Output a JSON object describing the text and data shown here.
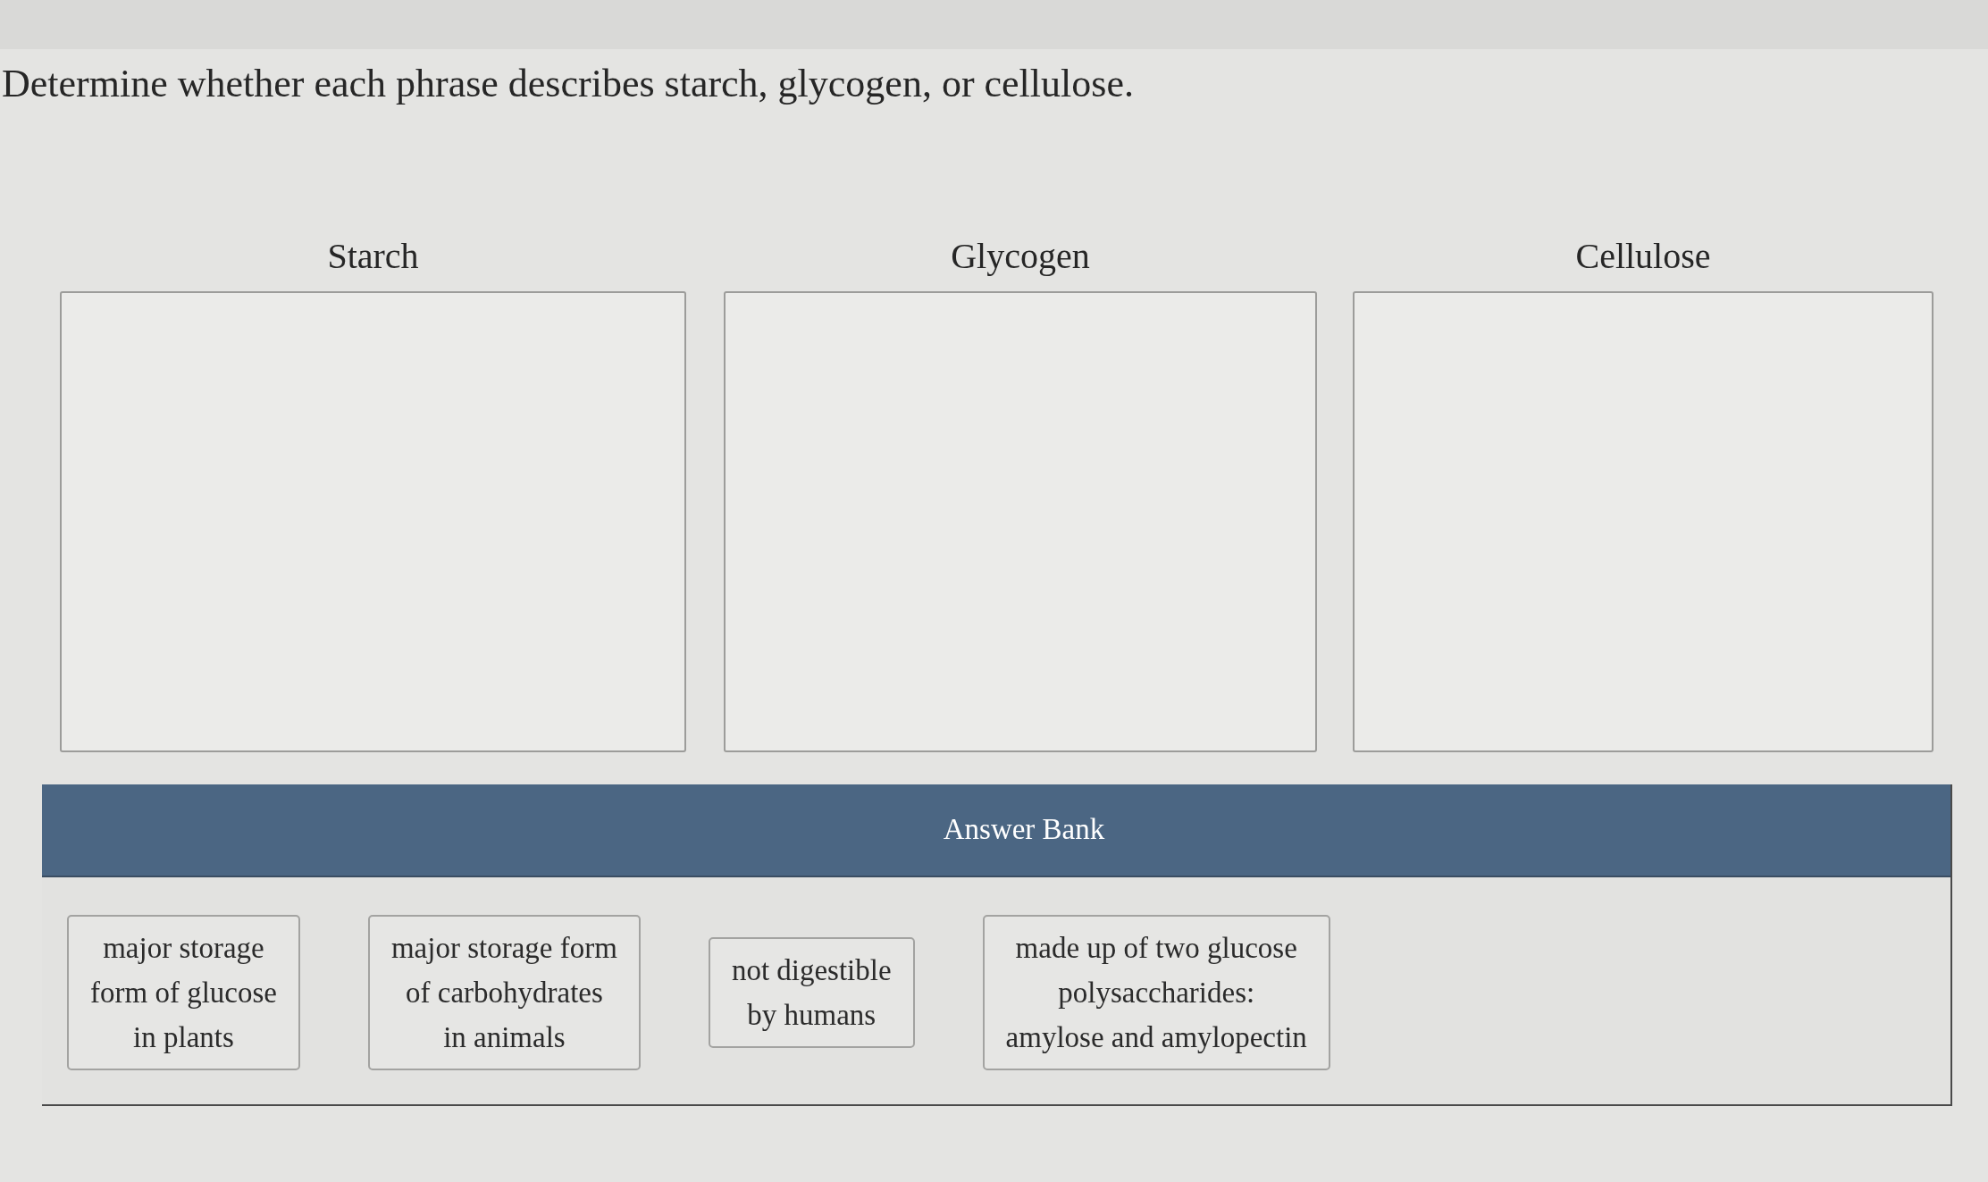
{
  "prompt": "Determine whether each phrase describes starch, glycogen, or cellulose.",
  "targets": [
    {
      "label": "Starch"
    },
    {
      "label": "Glycogen"
    },
    {
      "label": "Cellulose"
    }
  ],
  "answer_bank": {
    "title": "Answer Bank",
    "items": [
      {
        "lines": [
          "major storage",
          "form of glucose",
          "in plants"
        ]
      },
      {
        "lines": [
          "major storage form",
          "of carbohydrates",
          "in animals"
        ]
      },
      {
        "lines": [
          "not digestible",
          "by humans"
        ]
      },
      {
        "lines": [
          "made up of two glucose",
          "polysaccharides:",
          "amylose and amylopectin"
        ]
      }
    ]
  }
}
